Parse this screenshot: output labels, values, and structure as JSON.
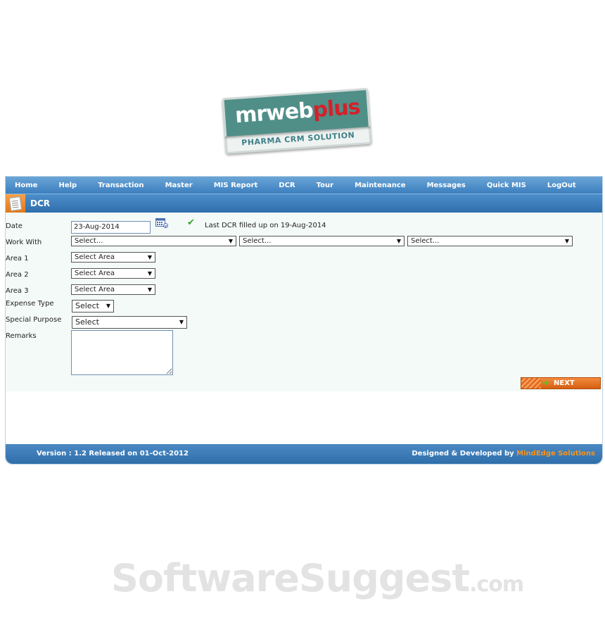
{
  "logo": {
    "brand_main": "mrweb",
    "brand_accent": "plus",
    "tagline": "PHARMA CRM SOLUTION"
  },
  "menu": [
    "Home",
    "Help",
    "Transaction",
    "Master",
    "MIS Report",
    "DCR",
    "Tour",
    "Maintenance",
    "Messages",
    "Quick MIS",
    "LogOut"
  ],
  "page": {
    "title": "DCR"
  },
  "form": {
    "date_label": "Date",
    "date_value": "23-Aug-2014",
    "last_dcr": "Last DCR filled up on 19-Aug-2014",
    "work_with_label": "Work With",
    "work_with": [
      "Select...",
      "Select...",
      "Select..."
    ],
    "area1_label": "Area 1",
    "area2_label": "Area 2",
    "area3_label": "Area 3",
    "area_placeholder": "Select Area",
    "expense_type_label": "Expense Type",
    "expense_type_value": "Select",
    "special_purpose_label": "Special Purpose",
    "special_purpose_value": "Select",
    "remarks_label": "Remarks",
    "next_label": "NEXT"
  },
  "footer": {
    "version": "Version : 1.2 Released on 01-Oct-2012",
    "designed_by": "Designed & Developed by ",
    "company": "MindEdge Solutions"
  },
  "watermark": {
    "main": "SoftwareSuggest",
    "suffix": ".com"
  },
  "colors": {
    "menu_blue": "#3c7fbf",
    "accent_orange": "#f7941d",
    "form_bg": "#f4faf8",
    "logo_teal": "#4f8f88",
    "logo_red": "#d5202a"
  }
}
